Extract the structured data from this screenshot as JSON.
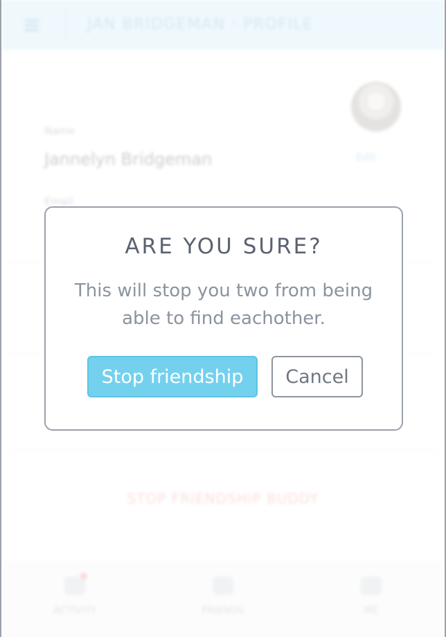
{
  "header": {
    "title": "JAN BRIDGEMAN · PROFILE"
  },
  "profile": {
    "name_label": "Name",
    "name_value": "Jannelyn Bridgeman",
    "avatar_edit_label": "Edit",
    "second_label": "Email"
  },
  "actions": {
    "stop_friendship_link": "STOP FRIENDSHIP BUDDY"
  },
  "tabbar": {
    "tabs": [
      {
        "label": "ACTIVITY",
        "icon": "bell-icon",
        "has_badge": true
      },
      {
        "label": "FRIENDS",
        "icon": "people-icon",
        "has_badge": false
      },
      {
        "label": "ME",
        "icon": "person-icon",
        "has_badge": false
      }
    ]
  },
  "dialog": {
    "title": "ARE YOU SURE?",
    "message": "This will stop you two from being able to find eachother.",
    "confirm_label": "Stop friendship",
    "cancel_label": "Cancel"
  },
  "colors": {
    "accent": "#74d1ee",
    "topbar": "#d4ecf8",
    "danger": "#f1a3a0",
    "dialog_border": "#9aa1aa"
  }
}
